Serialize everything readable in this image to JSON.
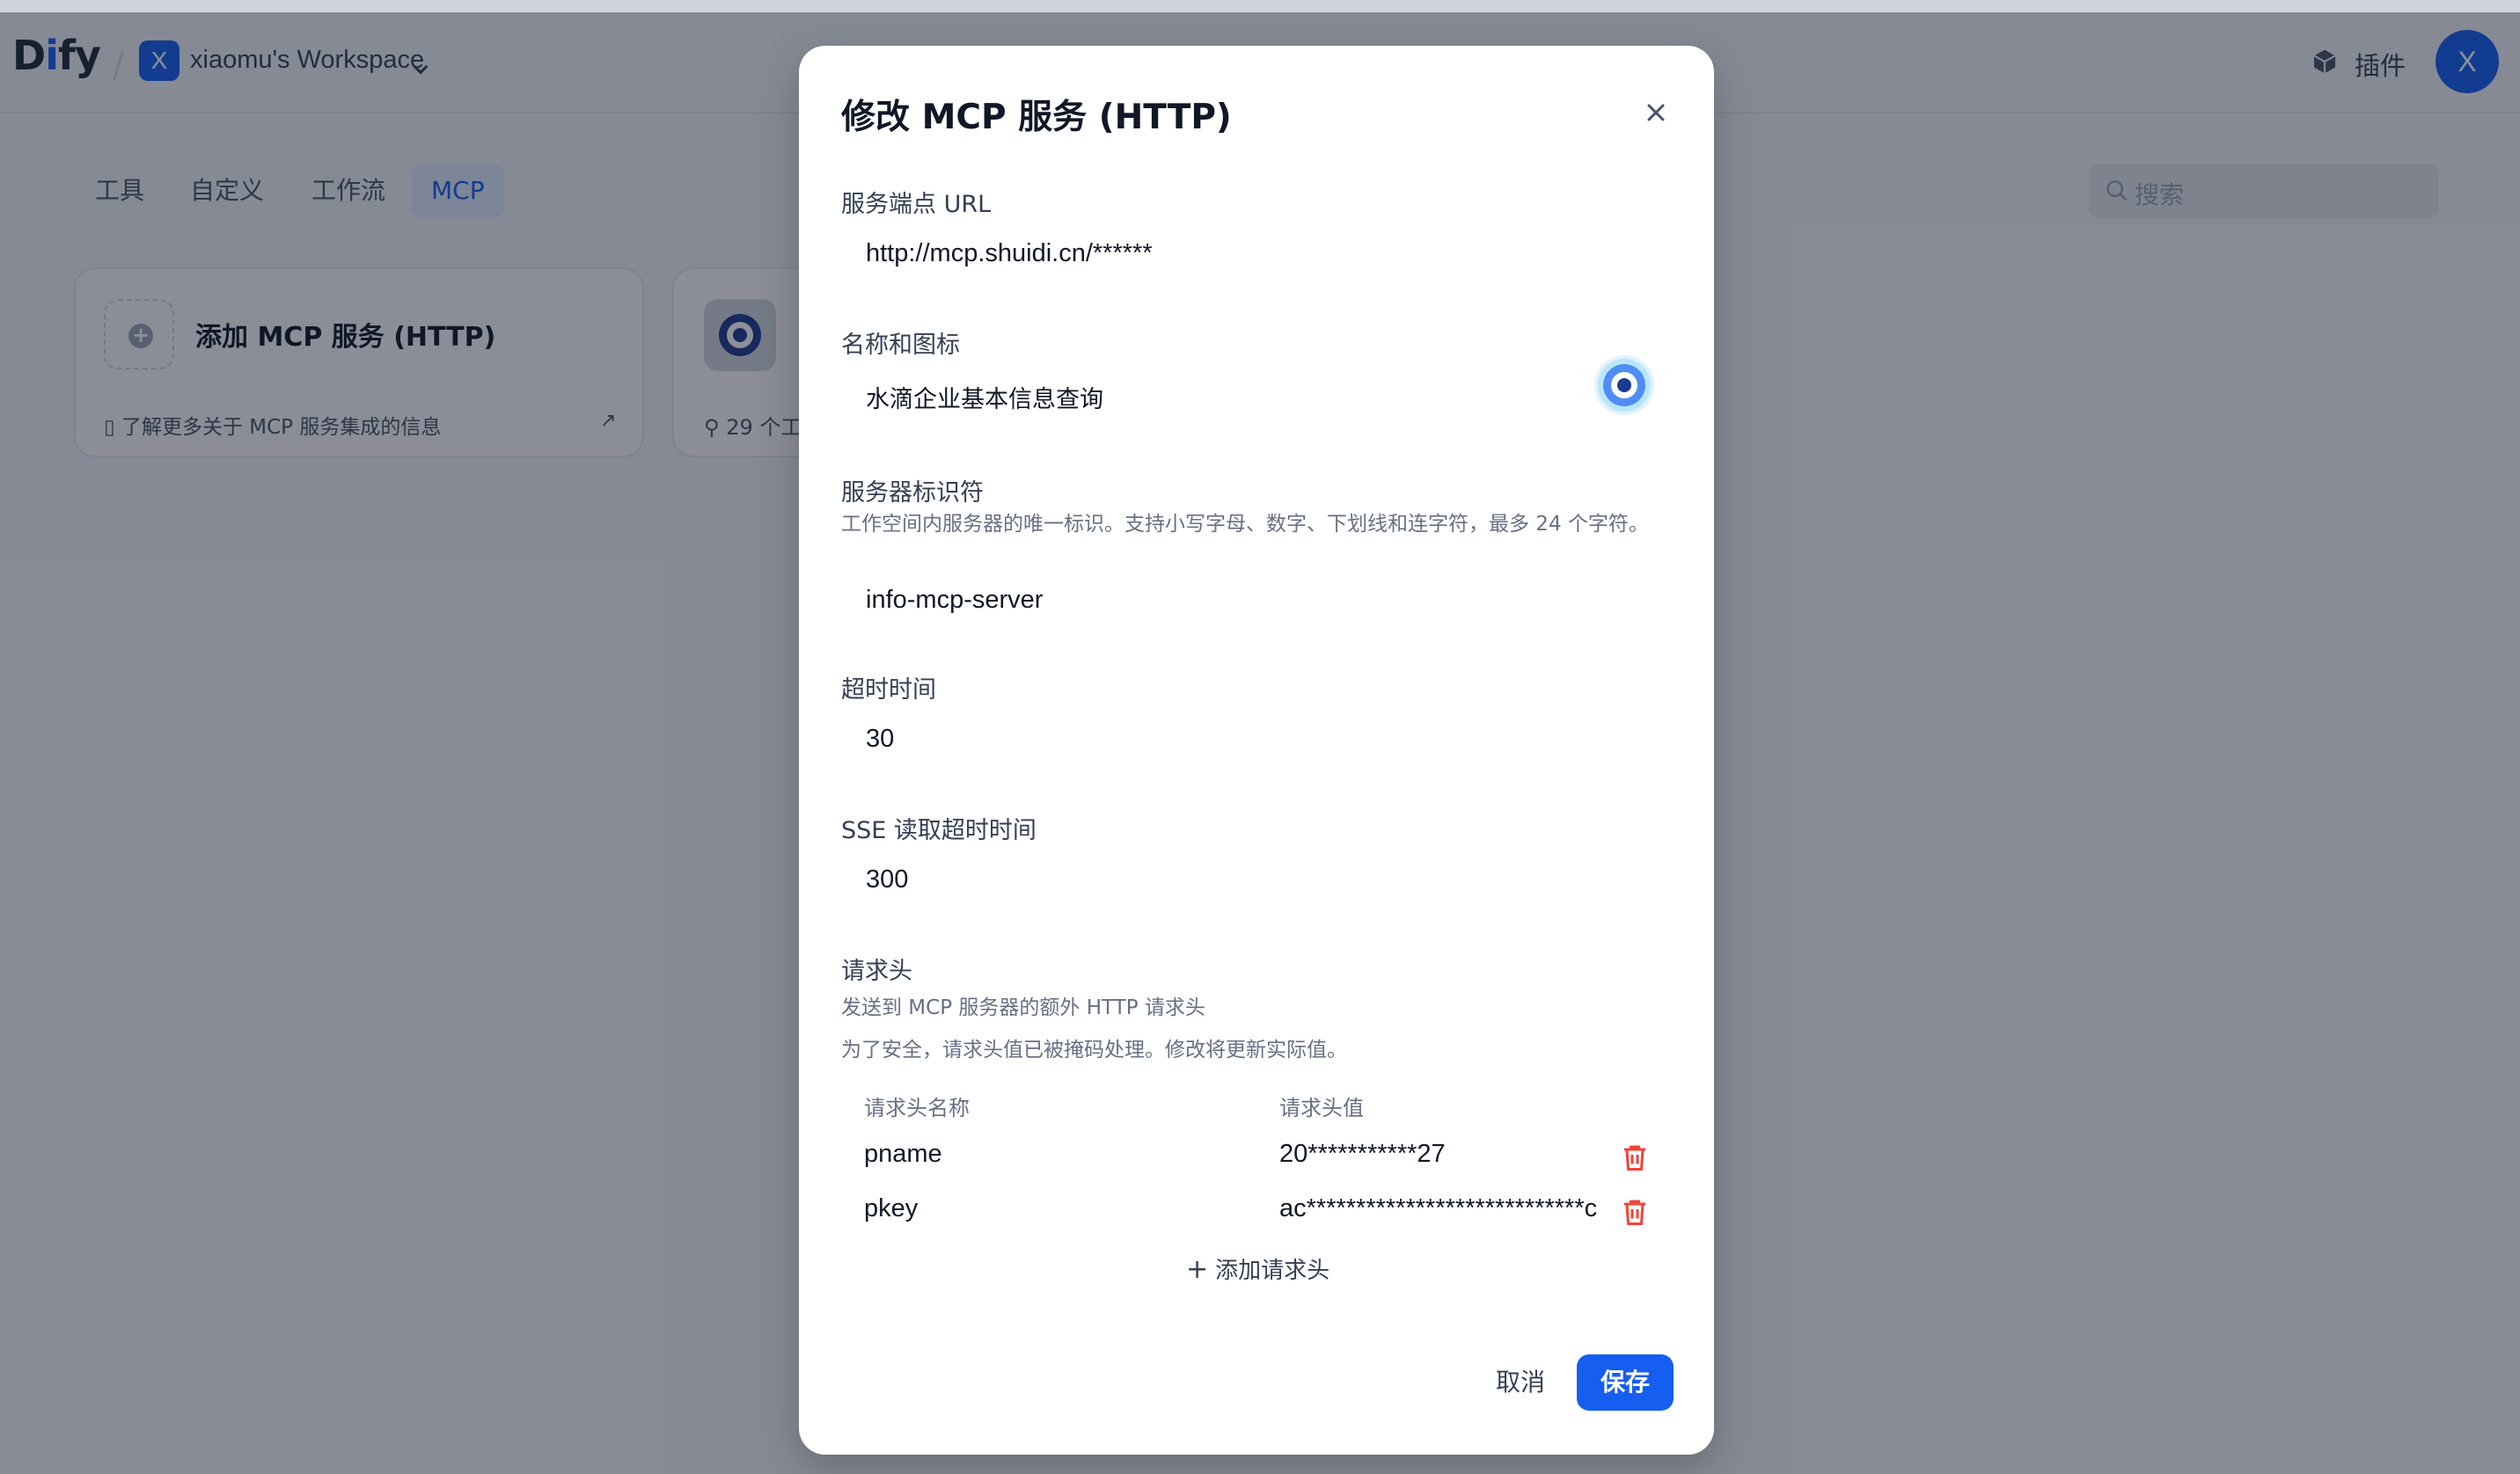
{
  "app": {
    "logo_prefix": "D",
    "logo_accent": "i",
    "logo_suffix": "fy",
    "workspace_initial": "X",
    "workspace_name": "xiaomu's Workspace",
    "plugins_label": "插件",
    "user_initial": "X",
    "tabs": [
      {
        "label": "工具",
        "active": false
      },
      {
        "label": "自定义",
        "active": false
      },
      {
        "label": "工作流",
        "active": false
      },
      {
        "label": "MCP",
        "active": true
      }
    ],
    "search_placeholder": "搜索",
    "add_card": {
      "title": "添加 MCP 服务 (HTTP)",
      "link": "了解更多关于 MCP 服务集成的信息"
    },
    "server_card": {
      "tools_count": "29 个工"
    }
  },
  "modal": {
    "title": "修改 MCP 服务 (HTTP)",
    "url": {
      "label": "服务端点 URL",
      "value": "http://mcp.shuidi.cn/******"
    },
    "name": {
      "label": "名称和图标",
      "value": "水滴企业基本信息查询"
    },
    "server_id": {
      "label": "服务器标识符",
      "desc": "工作空间内服务器的唯一标识。支持小写字母、数字、下划线和连字符，最多 24 个字符。",
      "value": "info-mcp-server"
    },
    "timeout": {
      "label": "超时时间",
      "value": "30"
    },
    "sse_timeout": {
      "label": "SSE 读取超时时间",
      "value": "300"
    },
    "headers": {
      "label": "请求头",
      "desc1": "发送到 MCP 服务器的额外 HTTP 请求头",
      "desc2": "为了安全，请求头值已被掩码处理。修改将更新实际值。",
      "col_name": "请求头名称",
      "col_value": "请求头值",
      "rows": [
        {
          "name": "pname",
          "value": "20***********27"
        },
        {
          "name": "pkey",
          "value": "ac****************************c"
        }
      ],
      "add_label": "添加请求头"
    },
    "cancel_label": "取消",
    "save_label": "保存"
  },
  "colors": {
    "primary": "#155eef",
    "danger": "#f04438",
    "overlay": "rgba(16,24,40,0.48)"
  }
}
